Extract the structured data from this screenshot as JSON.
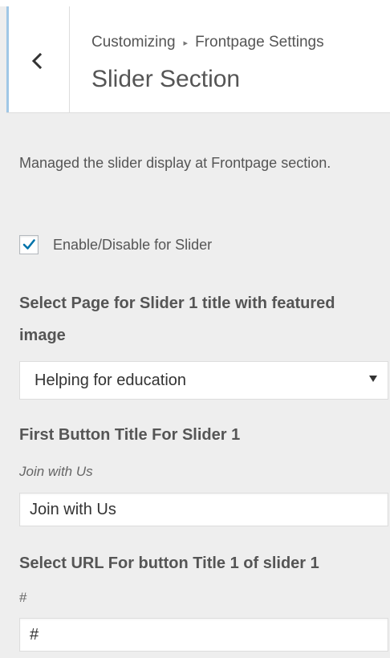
{
  "header": {
    "breadcrumb_root": "Customizing",
    "breadcrumb_separator": "▸",
    "breadcrumb_parent": "Frontpage Settings",
    "section_title": "Slider Section"
  },
  "section": {
    "description": "Managed the slider display at Frontpage section."
  },
  "enable_slider": {
    "label": "Enable/Disable for Slider",
    "checked": true
  },
  "slider1_page": {
    "label": "Select Page for Slider 1 title with featured image",
    "selected": "Helping for education"
  },
  "button1_title": {
    "label": "First Button Title For Slider 1",
    "description": "Join with Us",
    "value": "Join with Us"
  },
  "button1_url": {
    "label": "Select URL For button Title 1 of slider 1",
    "description": "#",
    "value": "#"
  },
  "colors": {
    "accent_checkmark": "#0073aa",
    "back_button_border": "#a0c7e6"
  },
  "icons": {
    "back": "chevron-left-icon",
    "check": "checkmark-icon",
    "select_arrow": "triangle-down-icon"
  }
}
